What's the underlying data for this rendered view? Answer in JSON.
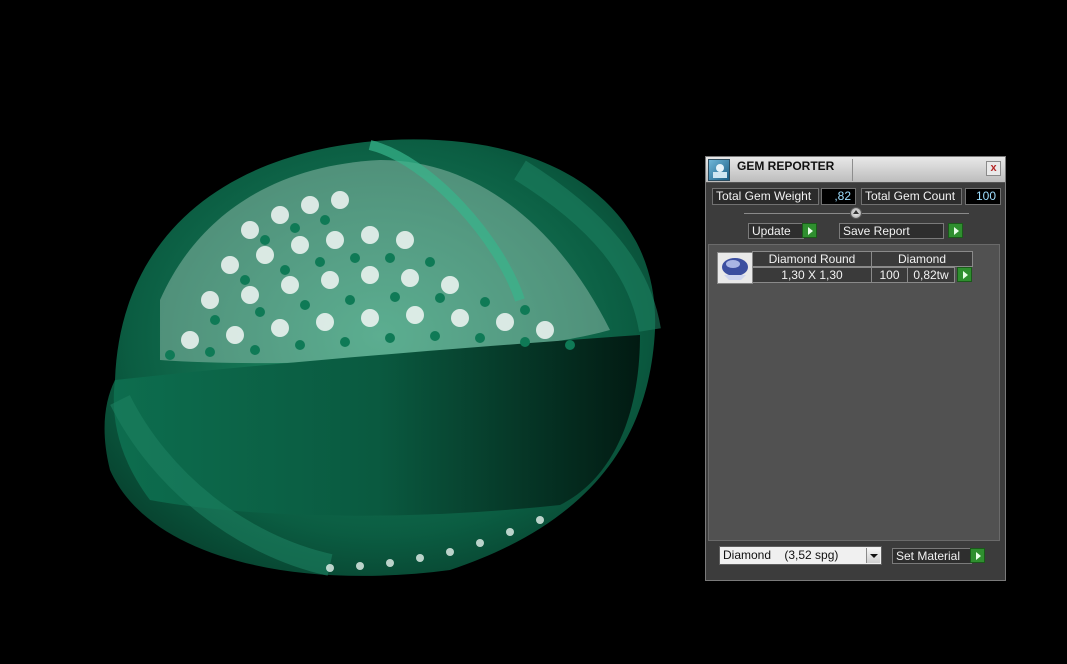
{
  "window": {
    "title": "GEM REPORTER",
    "close_label": "x"
  },
  "totals": {
    "weight_label": "Total Gem Weight",
    "weight_value": ",82",
    "count_label": "Total Gem Count",
    "count_value": "100"
  },
  "actions": {
    "update_label": "Update",
    "save_report_label": "Save Report"
  },
  "gem_list": {
    "rows": [
      {
        "name": "Diamond Round",
        "material": "Diamond",
        "size": "1,30 X 1,30",
        "count": "100",
        "weight": "0,82tw"
      }
    ]
  },
  "material": {
    "selected": "Diamond    (3,52 spg)",
    "set_material_label": "Set Material"
  },
  "colors": {
    "ring": "#0f6b4e",
    "panel": "#3c3c3c",
    "accent": "#2f8f2f",
    "value_text": "#9fdfff"
  },
  "icons": {
    "app": "gem-reporter-icon",
    "close": "close-icon",
    "thumb": "gem-thumbnail-icon"
  }
}
